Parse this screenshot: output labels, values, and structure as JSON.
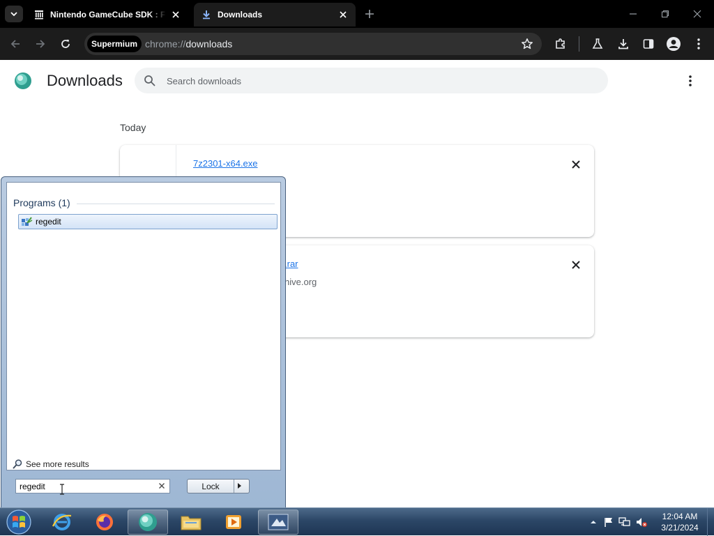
{
  "browser": {
    "tabs": [
      {
        "title": "Nintendo GameCube SDK : Free Download, Borrow, and Streaming",
        "active": false,
        "icon": "archive-columns-icon"
      },
      {
        "title": "Downloads",
        "active": true,
        "icon": "download-arrow-icon"
      }
    ],
    "chip": "Supermium",
    "url_scheme": "chrome://",
    "url_path": "downloads"
  },
  "downloads": {
    "title": "Downloads",
    "search_placeholder": "Search downloads",
    "section_date": "Today",
    "items": [
      {
        "filename": "7z2301-x64.exe",
        "source": ""
      },
      {
        "filename": ".rar",
        "source": "hive.org"
      }
    ]
  },
  "startmenu": {
    "heading": "Programs (1)",
    "results": [
      {
        "label": "regedit",
        "icon": "regedit-icon"
      }
    ],
    "see_more": "See more results",
    "search_value": "regedit",
    "lock_label": "Lock"
  },
  "taskbar": {
    "time": "12:04 AM",
    "date": "3/21/2024"
  },
  "colors": {
    "tabstrip": "#000000",
    "toolbar": "#1c1c1c",
    "link": "#1a73e8",
    "taskbar": "#2c4767"
  }
}
